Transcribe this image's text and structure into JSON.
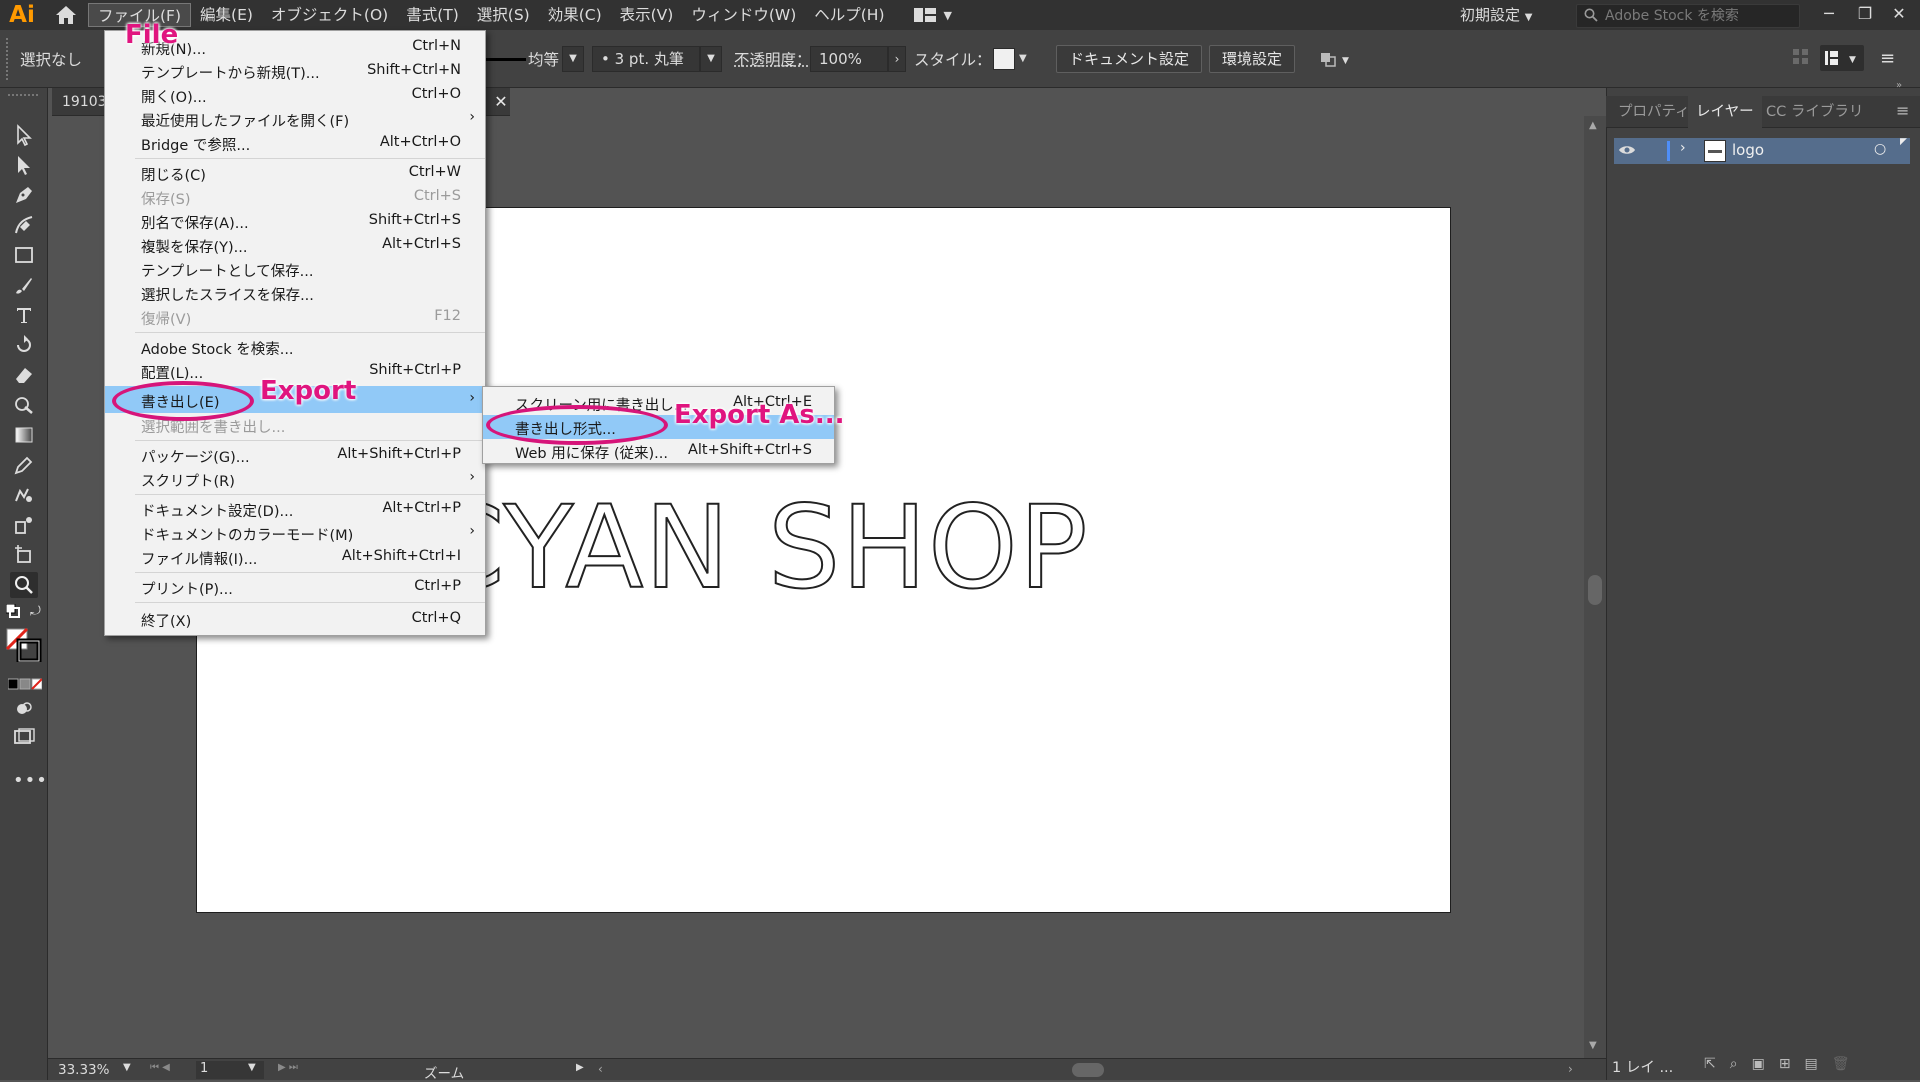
{
  "app": {
    "logo": "Ai",
    "preset": "初期設定",
    "search_placeholder": "Adobe Stock を検索"
  },
  "menubar": {
    "items": [
      "ファイル(F)",
      "編集(E)",
      "オブジェクト(O)",
      "書式(T)",
      "選択(S)",
      "効果(C)",
      "表示(V)",
      "ウィンドウ(W)",
      "ヘルプ(H)"
    ],
    "active_index": 0
  },
  "controlbar": {
    "selection": "選択なし",
    "stroke_profile": "均等",
    "brush": "3 pt. 丸筆",
    "opacity_label": "不透明度：",
    "opacity_value": "100%",
    "style_label": "スタイル：",
    "doc_settings_button": "ドキュメント設定",
    "prefs_button": "環境設定"
  },
  "document": {
    "tab_title": "191031",
    "artwork_text": "O-CYAN SHOP",
    "zoom": "33.33%",
    "artboard_number": "1",
    "status_label": "ズーム"
  },
  "panel": {
    "tabs": [
      "プロパティ",
      "レイヤー",
      "CC ライブラリ"
    ],
    "active_tab": 1,
    "layers": [
      {
        "name": "logo"
      }
    ],
    "layer_count": "1 レイ ..."
  },
  "file_menu": {
    "items": [
      {
        "label": "新規(N)...",
        "shortcut": "Ctrl+N"
      },
      {
        "label": "テンプレートから新規(T)...",
        "shortcut": "Shift+Ctrl+N"
      },
      {
        "label": "開く(O)...",
        "shortcut": "Ctrl+O"
      },
      {
        "label": "最近使用したファイルを開く(F)",
        "shortcut": ""
      },
      {
        "label": "Bridge で参照...",
        "shortcut": "Alt+Ctrl+O"
      },
      {
        "label": "閉じる(C)",
        "shortcut": "Ctrl+W"
      },
      {
        "label": "保存(S)",
        "shortcut": "Ctrl+S"
      },
      {
        "label": "別名で保存(A)...",
        "shortcut": "Shift+Ctrl+S"
      },
      {
        "label": "複製を保存(Y)...",
        "shortcut": "Alt+Ctrl+S"
      },
      {
        "label": "テンプレートとして保存...",
        "shortcut": ""
      },
      {
        "label": "選択したスライスを保存...",
        "shortcut": ""
      },
      {
        "label": "復帰(V)",
        "shortcut": "F12"
      },
      {
        "label": "Adobe Stock を検索...",
        "shortcut": ""
      },
      {
        "label": "配置(L)...",
        "shortcut": "Shift+Ctrl+P"
      },
      {
        "label": "書き出し(E)",
        "shortcut": ""
      },
      {
        "label": "選択範囲を書き出し...",
        "shortcut": ""
      },
      {
        "label": "パッケージ(G)...",
        "shortcut": "Alt+Shift+Ctrl+P"
      },
      {
        "label": "スクリプト(R)",
        "shortcut": ""
      },
      {
        "label": "ドキュメント設定(D)...",
        "shortcut": "Alt+Ctrl+P"
      },
      {
        "label": "ドキュメントのカラーモード(M)",
        "shortcut": ""
      },
      {
        "label": "ファイル情報(I)...",
        "shortcut": "Alt+Shift+Ctrl+I"
      },
      {
        "label": "プリント(P)...",
        "shortcut": "Ctrl+P"
      },
      {
        "label": "終了(X)",
        "shortcut": "Ctrl+Q"
      }
    ]
  },
  "export_submenu": {
    "items": [
      {
        "label": "スクリーン用に書き出し...",
        "shortcut": "Alt+Ctrl+E"
      },
      {
        "label": "書き出し形式...",
        "shortcut": ""
      },
      {
        "label": "Web 用に保存 (従来)...",
        "shortcut": "Alt+Shift+Ctrl+S"
      }
    ]
  },
  "annotations": {
    "file": "File",
    "export": "Export",
    "export_as": "Export As..."
  },
  "colors": {
    "highlight": "#91c9f7",
    "annotation": "#e0157f",
    "app_bg": "#535353"
  }
}
